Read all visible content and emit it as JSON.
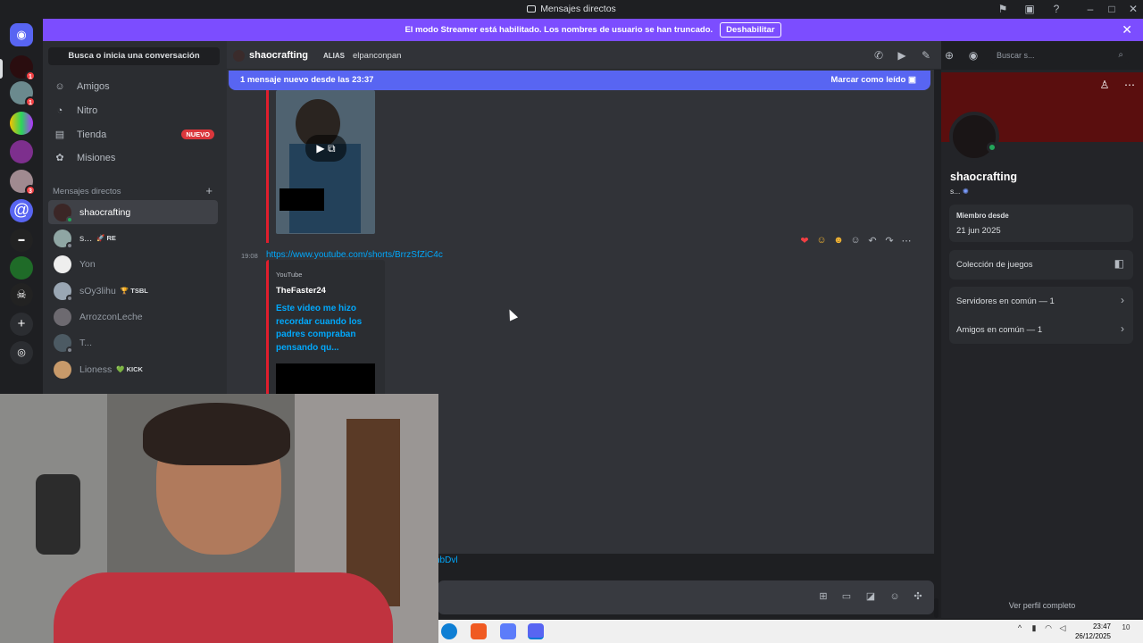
{
  "window": {
    "title": "Mensajes directos"
  },
  "banner": {
    "text": "El modo Streamer está habilitado. Los nombres de usuario se han truncado.",
    "button": "Deshabilitar"
  },
  "rail": {
    "badges": [
      "1",
      "1",
      "3"
    ]
  },
  "sidebar": {
    "search_placeholder": "Busca o inicia una conversación",
    "nav": [
      {
        "label": "Amigos",
        "icon": "friends-icon"
      },
      {
        "label": "Nitro",
        "icon": "nitro-icon"
      },
      {
        "label": "Tienda",
        "icon": "shop-icon",
        "badge": "NUEVO"
      },
      {
        "label": "Misiones",
        "icon": "quests-icon"
      }
    ],
    "dm_header": "Mensajes directos",
    "dms": [
      {
        "name": "shaocrafting",
        "selected": true,
        "tag": ""
      },
      {
        "name": "s...",
        "tag": "🚀 RE"
      },
      {
        "name": "Yon",
        "tag": ""
      },
      {
        "name": "sOy3lihu",
        "tag": "🏆 TSBL"
      },
      {
        "name": "ArrozconLeche",
        "tag": ""
      },
      {
        "name": "T...",
        "tag": ""
      },
      {
        "name": "Lioness",
        "tag": "💚 KICK"
      }
    ]
  },
  "header": {
    "name": "shaocrafting",
    "alias_label": "ALIAS",
    "alias_value": "elpanconpan",
    "search_placeholder": "Buscar s..."
  },
  "chat": {
    "new_messages": "1 mensaje nuevo desde las 23:37",
    "mark_read": "Marcar como leído",
    "timestamp": "19:08",
    "link": "https://www.youtube.com/shorts/BrrzSfZiC4c",
    "embed_provider": "YouTube",
    "embed_author": "TheFaster24",
    "embed_title": "Este video me hizo recordar cuando los padres compraban pensando qu...",
    "trailing_link": "nbDvl"
  },
  "profile": {
    "name": "shaocrafting",
    "sub": "s...",
    "member_since_label": "Miembro desde",
    "member_since": "21 jun 2025",
    "games": "Colección de juegos",
    "servers": "Servidores en común — 1",
    "friends": "Amigos en común — 1",
    "full_profile": "Ver perfil completo"
  },
  "taskbar": {
    "time": "23:47",
    "date": "26/12/2025",
    "notif": "10"
  },
  "colors": {
    "accent": "#5865f2",
    "streamer": "#7c4dff",
    "embed_bar": "#e01e2d",
    "online": "#23a55a",
    "link": "#00a8fc"
  }
}
